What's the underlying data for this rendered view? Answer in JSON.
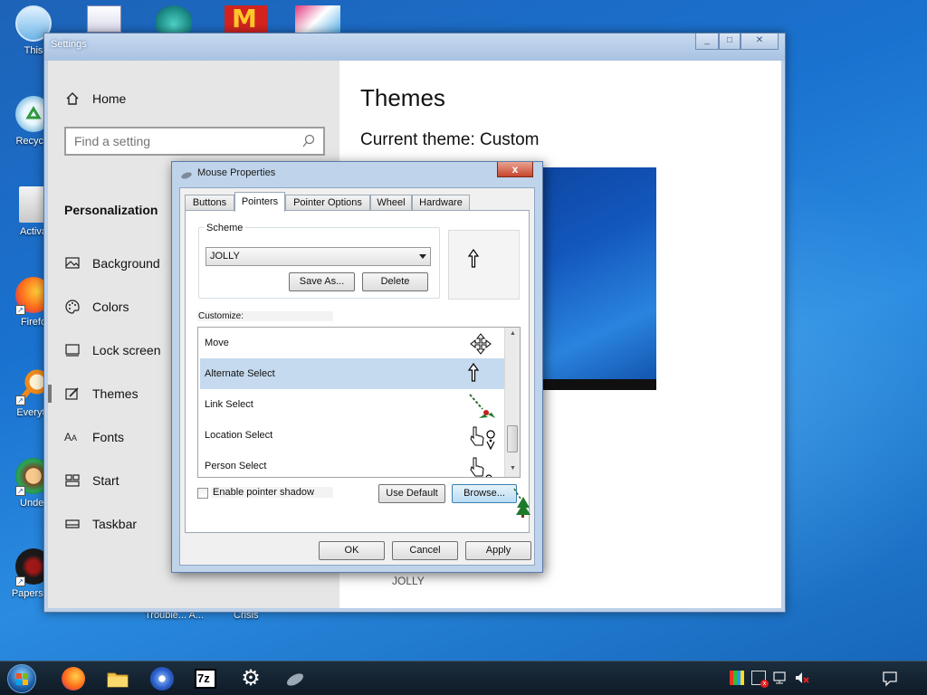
{
  "desktop": {
    "icons": [
      {
        "label": "This",
        "icon": "this-pc-icon"
      },
      {
        "label": "Recycle",
        "icon": "recycle-bin-icon"
      },
      {
        "label": "Activa",
        "icon": "activate-icon"
      },
      {
        "label": "Firefo",
        "icon": "firefox-icon"
      },
      {
        "label": "Everyth",
        "icon": "everything-search-icon"
      },
      {
        "label": "Under",
        "icon": "undertale-icon"
      },
      {
        "label": "Papers, P",
        "icon": "papers-please-icon"
      }
    ],
    "bottom_labels": [
      "Trouble... A...",
      "Crisis"
    ]
  },
  "settings": {
    "title": "Settings",
    "nav": {
      "home": "Home",
      "search_placeholder": "Find a setting",
      "section": "Personalization",
      "items": [
        "Background",
        "Colors",
        "Lock screen",
        "Themes",
        "Fonts",
        "Start",
        "Taskbar"
      ],
      "selected": "Themes"
    },
    "content": {
      "title": "Themes",
      "current_theme": "Current theme: Custom",
      "theme_label": "JOLLY"
    }
  },
  "mouse_dialog": {
    "title": "Mouse Properties",
    "close_label": "x",
    "tabs": [
      "Buttons",
      "Pointers",
      "Pointer Options",
      "Wheel",
      "Hardware"
    ],
    "active_tab": "Pointers",
    "scheme": {
      "group_label": "Scheme",
      "value": "JOLLY",
      "save_as": "Save As...",
      "delete": "Delete"
    },
    "customize_label": "Customize:",
    "pointers": [
      {
        "name": "Move",
        "icon": "move-cursor-icon",
        "selected": false
      },
      {
        "name": "Alternate Select",
        "icon": "up-arrow-cursor-icon",
        "selected": true
      },
      {
        "name": "Link Select",
        "icon": "holly-cursor-icon",
        "selected": false
      },
      {
        "name": "Location Select",
        "icon": "hand-location-cursor-icon",
        "selected": false
      },
      {
        "name": "Person Select",
        "icon": "hand-person-cursor-icon",
        "selected": false
      }
    ],
    "enable_shadow_label": "Enable pointer shadow",
    "enable_shadow_checked": false,
    "use_default": "Use Default",
    "browse": "Browse...",
    "ok": "OK",
    "cancel": "Cancel",
    "apply": "Apply"
  },
  "taskbar": {
    "pinned": [
      "start-orb-icon",
      "firefox-icon",
      "file-explorer-icon",
      "disc-app-icon",
      "7zip-icon",
      "settings-gear-icon",
      "mouse-app-icon"
    ],
    "seven_zip_label": "7z",
    "tray": [
      "color-flag-icon",
      "action-center-flag-icon",
      "network-icon",
      "volume-muted-icon",
      "notifications-icon"
    ]
  }
}
